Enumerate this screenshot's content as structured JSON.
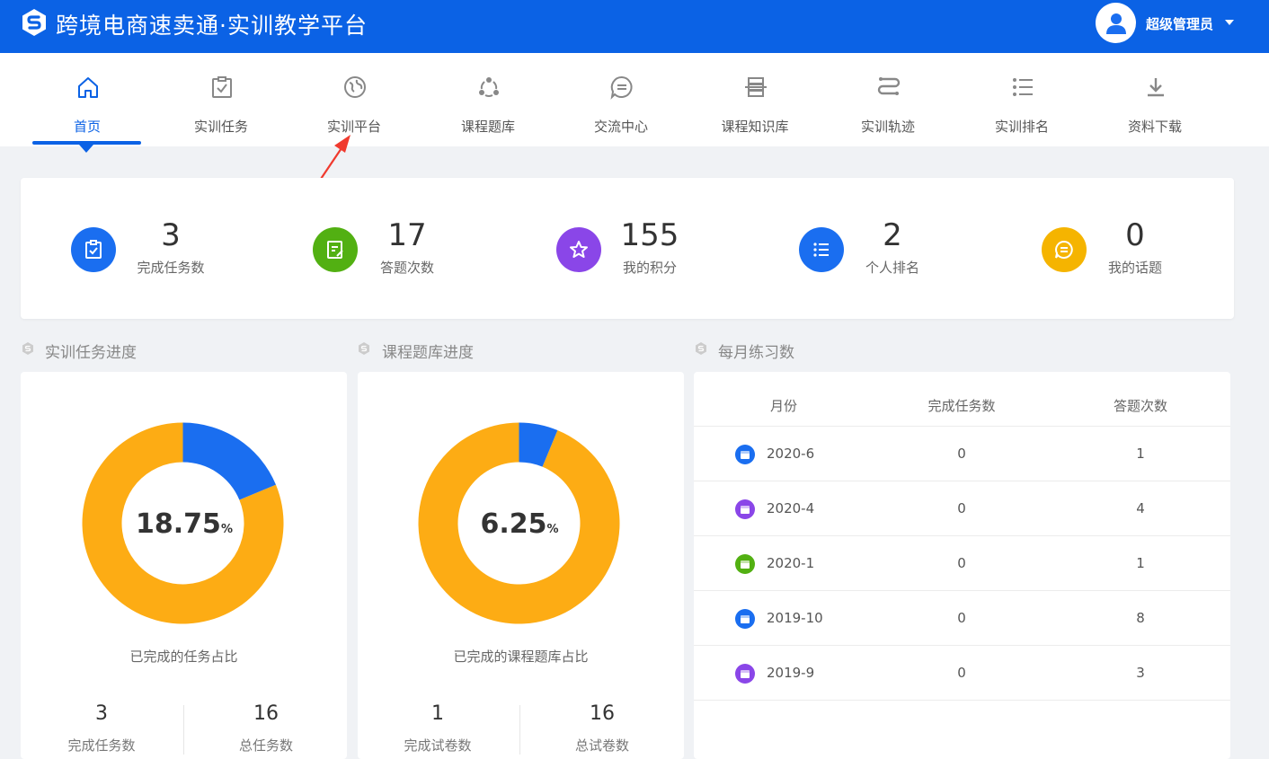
{
  "header": {
    "title": "跨境电商速卖通·实训教学平台",
    "user_name": "超级管理员",
    "brand_color": "#0b62e5"
  },
  "nav": {
    "items": [
      {
        "label": "首页",
        "icon": "home-icon",
        "active": true
      },
      {
        "label": "实训任务",
        "icon": "clipboard-check-icon"
      },
      {
        "label": "实训平台",
        "icon": "globe-icon"
      },
      {
        "label": "课程题库",
        "icon": "nodes-icon"
      },
      {
        "label": "交流中心",
        "icon": "chat-icon"
      },
      {
        "label": "课程知识库",
        "icon": "database-icon"
      },
      {
        "label": "实训轨迹",
        "icon": "route-icon"
      },
      {
        "label": "实训排名",
        "icon": "list-icon"
      },
      {
        "label": "资料下载",
        "icon": "download-icon"
      }
    ]
  },
  "stats": [
    {
      "value": "3",
      "label": "完成任务数",
      "icon": "clipboard-check-icon",
      "color": "#1a6ef0"
    },
    {
      "value": "17",
      "label": "答题次数",
      "icon": "edit-note-icon",
      "color": "#52b012"
    },
    {
      "value": "155",
      "label": "我的积分",
      "icon": "star-icon",
      "color": "#8a46e8"
    },
    {
      "value": "2",
      "label": "个人排名",
      "icon": "list-icon",
      "color": "#1a6ef0"
    },
    {
      "value": "0",
      "label": "我的话题",
      "icon": "chat-icon",
      "color": "#f5b400"
    }
  ],
  "sections": {
    "task_progress": "实训任务进度",
    "quiz_progress": "课程题库进度",
    "monthly": "每月练习数"
  },
  "task_panel": {
    "percent": 18.75,
    "percent_text": "18.75",
    "unit": "%",
    "caption": "已完成的任务占比",
    "done_value": "3",
    "done_label": "完成任务数",
    "total_value": "16",
    "total_label": "总任务数"
  },
  "quiz_panel": {
    "percent": 6.25,
    "percent_text": "6.25",
    "unit": "%",
    "caption": "已完成的课程题库占比",
    "done_value": "1",
    "done_label": "完成试卷数",
    "total_value": "16",
    "total_label": "总试卷数"
  },
  "colors": {
    "done": "#1a6ef0",
    "remaining": "#fdac14"
  },
  "monthly_table": {
    "headers": [
      "月份",
      "完成任务数",
      "答题次数"
    ],
    "rows": [
      {
        "month": "2020-6",
        "tasks": "0",
        "answers": "1",
        "icon_color": "#1a6ef0"
      },
      {
        "month": "2020-4",
        "tasks": "0",
        "answers": "4",
        "icon_color": "#8a46e8"
      },
      {
        "month": "2020-1",
        "tasks": "0",
        "answers": "1",
        "icon_color": "#52b012"
      },
      {
        "month": "2019-10",
        "tasks": "0",
        "answers": "8",
        "icon_color": "#1a6ef0"
      },
      {
        "month": "2019-9",
        "tasks": "0",
        "answers": "3",
        "icon_color": "#8a46e8"
      }
    ]
  }
}
